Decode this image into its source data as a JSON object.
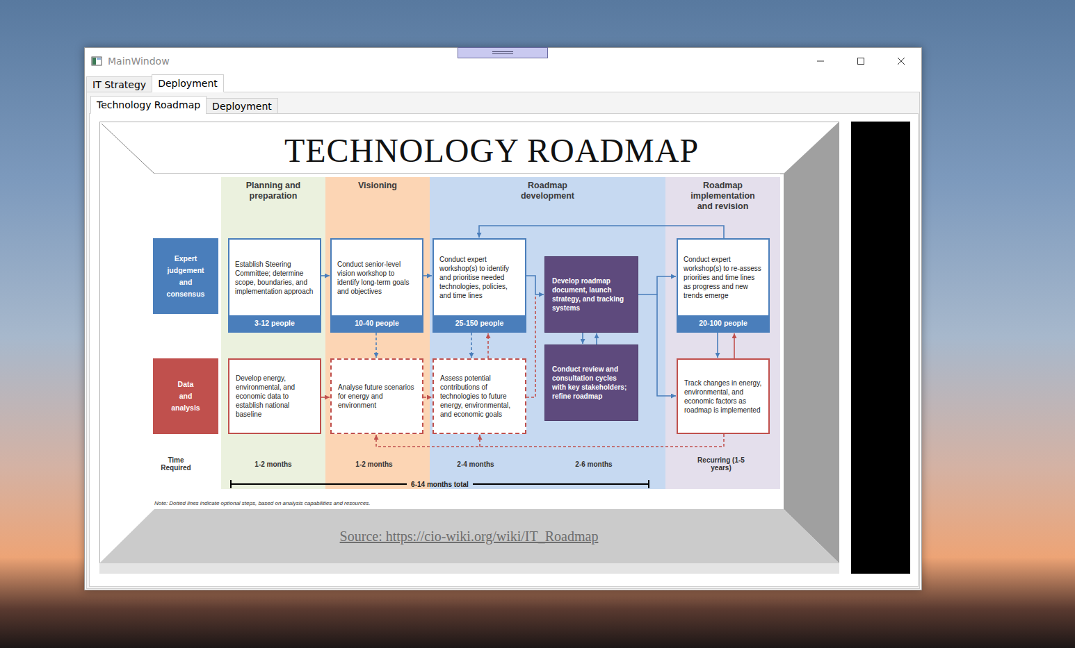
{
  "window": {
    "title": "MainWindow"
  },
  "outer_tabs": [
    {
      "label": "IT Strategy",
      "selected": false
    },
    {
      "label": "Deployment",
      "selected": true
    }
  ],
  "inner_tabs": [
    {
      "label": "Technology Roadmap",
      "selected": true
    },
    {
      "label": "Deployment",
      "selected": false
    }
  ],
  "roadmap": {
    "title": "TECHNOLOGY ROADMAP",
    "phases": [
      {
        "label": "Planning and preparation",
        "color": "#ebf1de"
      },
      {
        "label": "Visioning",
        "color": "#fcd5b4"
      },
      {
        "label": "Roadmap development",
        "color": "#c6d9f1"
      },
      {
        "label": "Roadmap implementation and revision",
        "color": "#e4dfec"
      }
    ],
    "lanes": [
      {
        "label": "Expert judgement and consensus",
        "color": "#4a7ebb"
      },
      {
        "label": "Data and analysis",
        "color": "#c0504d"
      }
    ],
    "nodes": [
      {
        "kind": "expert",
        "text": "Establish Steering Committee; determine scope, boundaries, and implementation approach",
        "people": "3-12 people",
        "optional": false
      },
      {
        "kind": "data",
        "text": "Develop energy, environmental, and economic data to establish national baseline",
        "optional": false
      },
      {
        "kind": "expert",
        "text": "Conduct senior-level vision workshop to identify long-term goals and objectives",
        "people": "10-40 people",
        "optional": false
      },
      {
        "kind": "data",
        "text": "Analyse future scenarios for energy and environment",
        "optional": true
      },
      {
        "kind": "expert",
        "text": "Conduct expert workshop(s) to identify and prioritise needed technologies, policies, and time lines",
        "people": "25-150 people",
        "optional": false
      },
      {
        "kind": "data",
        "text": "Assess potential contributions of technologies to future energy, environmental, and economic goals",
        "optional": true
      },
      {
        "kind": "review",
        "text": "Develop roadmap document, launch strategy, and tracking systems",
        "optional": false
      },
      {
        "kind": "review",
        "text": "Conduct review and consultation cycles with key stakeholders; refine roadmap",
        "optional": false
      },
      {
        "kind": "expert",
        "text": "Conduct expert workshop(s) to re-assess priorities and time lines as progress and new trends emerge",
        "people": "20-100 people",
        "optional": false
      },
      {
        "kind": "data",
        "text": "Track changes in energy, environmental, and economic factors as roadmap is implemented",
        "optional": false
      }
    ],
    "time_label": "Time Required",
    "times": [
      "1-2 months",
      "1-2 months",
      "2-4 months",
      "2-6 months",
      "Recurring (1-5 years)"
    ],
    "total": "6-14 months total",
    "note": "Note: Dotted lines indicate optional steps, based on analysis capabilities and resources.",
    "source": "Source: https://cio-wiki.org/wiki/IT_Roadmap"
  }
}
